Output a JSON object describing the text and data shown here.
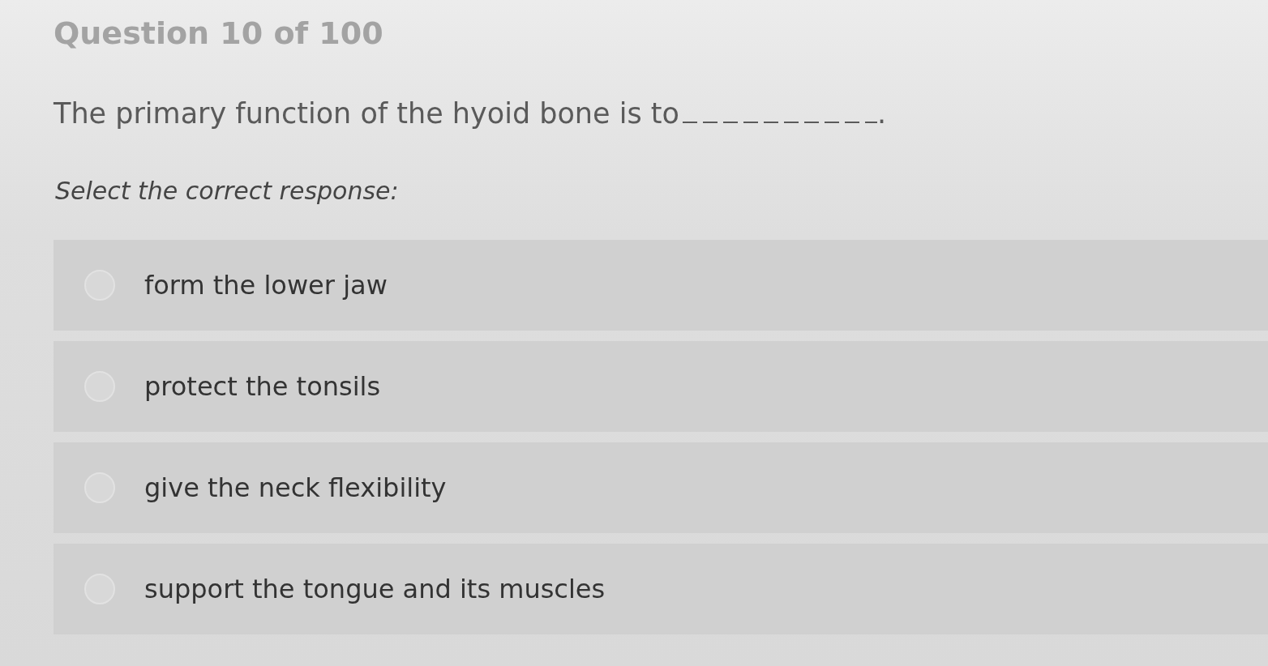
{
  "header": {
    "title": "Question 10 of 100"
  },
  "question": {
    "parts": [
      {
        "kind": "text",
        "text": "The primary function of the hyoid bone is to"
      },
      {
        "kind": "blank"
      },
      {
        "kind": "text",
        "text": "."
      }
    ]
  },
  "instruction": "Select the correct response:",
  "options": [
    {
      "label": "form the lower jaw",
      "selected": false
    },
    {
      "label": "protect the tonsils",
      "selected": false
    },
    {
      "label": "give the neck flexibility",
      "selected": false
    },
    {
      "label": "support the tongue and its muscles",
      "selected": false
    }
  ]
}
